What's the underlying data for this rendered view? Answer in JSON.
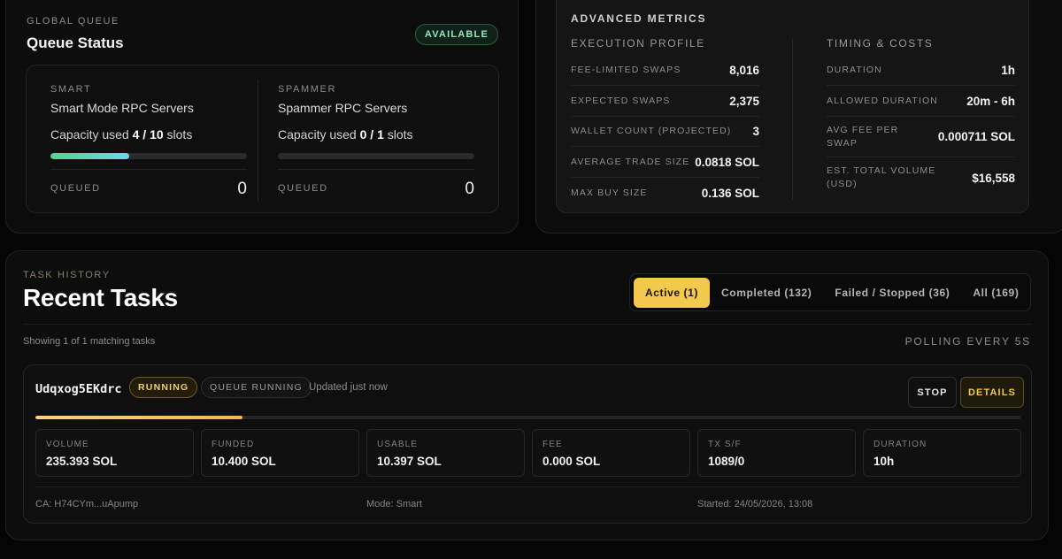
{
  "queue": {
    "eyebrow": "Global Queue",
    "title": "Queue Status",
    "status_badge": "AVAILABLE",
    "smart": {
      "label": "Smart",
      "subtitle": "Smart Mode RPC Servers",
      "capacity_prefix": "Capacity used",
      "capacity_value": "4 / 10",
      "capacity_suffix": "slots",
      "capacity_fraction": 0.4,
      "queued_label": "Queued",
      "queued_value": "0"
    },
    "spammer": {
      "label": "Spammer",
      "subtitle": "Spammer RPC Servers",
      "capacity_prefix": "Capacity used",
      "capacity_value": "0 / 1",
      "capacity_suffix": "slots",
      "capacity_fraction": 0.0,
      "queued_label": "Queued",
      "queued_value": "0"
    }
  },
  "metrics": {
    "title": "Advanced Metrics",
    "execution": {
      "heading": "Execution Profile",
      "rows": [
        {
          "key": "Fee-limited swaps",
          "value": "8,016"
        },
        {
          "key": "Expected swaps",
          "value": "2,375"
        },
        {
          "key": "Wallet count (projected)",
          "value": "3"
        },
        {
          "key": "Average trade size",
          "value": "0.0818 SOL"
        },
        {
          "key": "Max buy size",
          "value": "0.136 SOL"
        }
      ]
    },
    "timing": {
      "heading": "Timing & Costs",
      "rows": [
        {
          "key": "Duration",
          "value": "1h"
        },
        {
          "key": "Allowed duration",
          "value": "20m - 6h"
        },
        {
          "key": "Avg fee per swap",
          "value": "0.000711 SOL"
        },
        {
          "key": "Est. total volume (USD)",
          "value": "$16,558"
        }
      ]
    }
  },
  "tasks": {
    "eyebrow": "Task History",
    "title": "Recent Tasks",
    "filters": [
      {
        "label": "Active (1)",
        "active": true
      },
      {
        "label": "Completed (132)",
        "active": false
      },
      {
        "label": "Failed / Stopped (36)",
        "active": false
      },
      {
        "label": "All (169)",
        "active": false
      }
    ],
    "showing": "Showing 1 of 1 matching tasks",
    "polling": "Polling every 5s",
    "task": {
      "id": "Udqxog5EKdrc",
      "status": "Running",
      "queue_status": "Queue running",
      "updated": "Updated just now",
      "stop_label": "Stop",
      "details_label": "Details",
      "progress_fraction": 0.21,
      "stats": [
        {
          "label": "Volume",
          "value": "235.393 SOL"
        },
        {
          "label": "Funded",
          "value": "10.400 SOL"
        },
        {
          "label": "Usable",
          "value": "10.397 SOL"
        },
        {
          "label": "Fee",
          "value": "0.000 SOL"
        },
        {
          "label": "TX S/F",
          "value": "1089/0"
        },
        {
          "label": "Duration",
          "value": "10h"
        }
      ],
      "ca": "CA: H74CYm...uApump",
      "mode": "Mode: Smart",
      "started": "Started: 24/05/2026, 13:08"
    }
  }
}
